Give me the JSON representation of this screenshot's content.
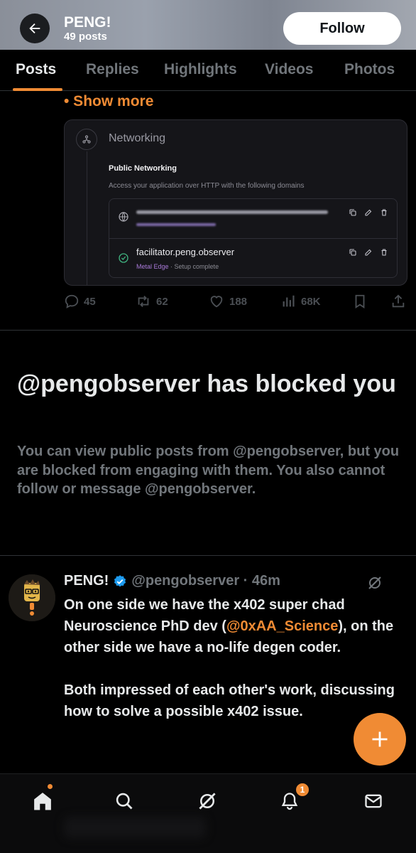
{
  "header": {
    "title": "PENG!",
    "post_count": "49 posts",
    "follow_label": "Follow"
  },
  "tabs": [
    {
      "label": "Posts",
      "active": true
    },
    {
      "label": "Replies",
      "active": false
    },
    {
      "label": "Highlights",
      "active": false
    },
    {
      "label": "Videos",
      "active": false
    },
    {
      "label": "Photos",
      "active": false
    }
  ],
  "previous_post": {
    "show_more_label": "• Show more",
    "embed": {
      "section_title": "Networking",
      "public_title": "Public Networking",
      "public_desc": "Access your application over HTTP with the following domains",
      "domain_2": "facilitator.peng.observer",
      "domain_2_edge": "Metal Edge",
      "domain_2_status": " · Setup complete"
    },
    "stats": {
      "replies": "45",
      "reposts": "62",
      "likes": "188",
      "views": "68K"
    }
  },
  "blocked": {
    "title": "@pengobserver has blocked you",
    "description": "You can view public posts from @pengobserver, but you are blocked from engaging with them. You also cannot follow or message @pengobserver."
  },
  "post": {
    "name": "PENG!",
    "handle_time": "@pengobserver · 46m",
    "line1_before": "On one side we have the x402 super chad Neuroscience PhD dev (",
    "mention": "@0xAA_Science",
    "line1_after": "), on the other side we have a no-life degen coder.",
    "para2": "Both impressed of each other's work, discussing how to solve a possible x402 issue."
  },
  "bottom_nav": {
    "notification_count": "1"
  },
  "colors": {
    "accent": "#f08b34",
    "background": "#000000",
    "muted": "#71767b"
  }
}
